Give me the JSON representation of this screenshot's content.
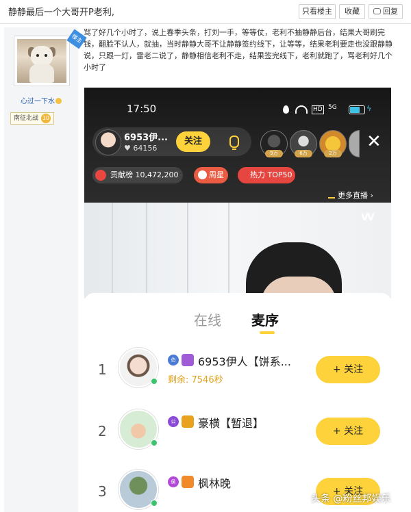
{
  "header": {
    "thread_title": "静静最后一个大哥开P老利,",
    "only_op_label": "只看楼主",
    "favorite_label": "收藏",
    "reply_label": "回复"
  },
  "author": {
    "op_badge": "楼主",
    "username": "心过一下水",
    "tag": "南征北战",
    "level": "10"
  },
  "post": {
    "text": "骂了好几个小时了，说上春季头条，打刘一手，等等仗，老利不抽静静后台，结果大哥刷完钱，翻脸不认人，就抽，当时静静大哥不让静静签约线下，让等等，结果老利要走也没跟静静说，只跟一灯，雷老二说了，静静相信老利不走，结果签完线下，老利就跑了，骂老利好几个小时了"
  },
  "phone": {
    "status_time": "17:50",
    "status_hd": "HD",
    "status_signal": "5G",
    "host_name": "6953伊...",
    "host_likes": "64156",
    "follow_label": "关注",
    "viewers": [
      "9万",
      "6万",
      "2万"
    ],
    "contrib_label": "贡献榜 10,472,200",
    "star_label": "周星",
    "hot_label": "热力 TOP50",
    "more_live": "更多直播",
    "video_icon": "VV",
    "tab_online": "在线",
    "tab_queue": "麦序",
    "queue": [
      {
        "rank": "1",
        "badge_a": "伯",
        "name": "6953伊人【饼系...",
        "sub": "剩余: 7546秒",
        "follow": "+ 关注"
      },
      {
        "rank": "2",
        "badge_a": "公",
        "name": "豪横【暂退】",
        "sub": "",
        "follow": "+ 关注"
      },
      {
        "rank": "3",
        "badge_a": "侯",
        "name": "枫林晚",
        "sub": "",
        "follow": "+ 关注"
      }
    ]
  },
  "watermark": "头条 @粉丝邦娱乐",
  "colors": {
    "accent": "#fdd23b",
    "link": "#2d64b3",
    "live_red": "#e5463f"
  }
}
